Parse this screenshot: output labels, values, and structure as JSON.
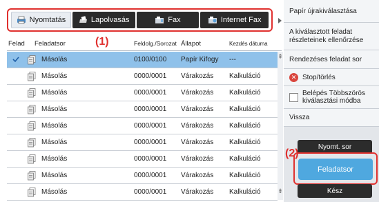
{
  "tabs": [
    {
      "label": "Nyomtatás",
      "icon": "printer-icon",
      "active": true
    },
    {
      "label": "Lapolvasás",
      "icon": "scanner-icon",
      "active": false
    },
    {
      "label": "Fax",
      "icon": "fax-icon",
      "active": false
    },
    {
      "label": "Internet Fax",
      "icon": "internet-fax-icon",
      "active": false
    }
  ],
  "annotations": {
    "one": "(1)",
    "two": "(2)"
  },
  "table": {
    "headers": {
      "feladat": "Felad",
      "feladatsor": "Feladatsor",
      "sorozat": "Feldolg./Sorozat",
      "allapot": "Állapot",
      "kezdes": "Kezdés dátuma"
    },
    "rows": [
      {
        "feladatsor": "Másolás",
        "sorozat": "0100/0100",
        "allapot": "Papír Kifogy",
        "kezdes": "---",
        "selected": true
      },
      {
        "feladatsor": "Másolás",
        "sorozat": "0000/0001",
        "allapot": "Várakozás",
        "kezdes": "Kalkuláció",
        "selected": false
      },
      {
        "feladatsor": "Másolás",
        "sorozat": "0000/0001",
        "allapot": "Várakozás",
        "kezdes": "Kalkuláció",
        "selected": false
      },
      {
        "feladatsor": "Másolás",
        "sorozat": "0000/0001",
        "allapot": "Várakozás",
        "kezdes": "Kalkuláció",
        "selected": false
      },
      {
        "feladatsor": "Másolás",
        "sorozat": "0000/0001",
        "allapot": "Várakozás",
        "kezdes": "Kalkuláció",
        "selected": false
      },
      {
        "feladatsor": "Másolás",
        "sorozat": "0000/0001",
        "allapot": "Várakozás",
        "kezdes": "Kalkuláció",
        "selected": false
      },
      {
        "feladatsor": "Másolás",
        "sorozat": "0000/0001",
        "allapot": "Várakozás",
        "kezdes": "Kalkuláció",
        "selected": false
      },
      {
        "feladatsor": "Másolás",
        "sorozat": "0000/0001",
        "allapot": "Várakozás",
        "kezdes": "Kalkuláció",
        "selected": false
      },
      {
        "feladatsor": "Másolás",
        "sorozat": "0000/0001",
        "allapot": "Várakozás",
        "kezdes": "Kalkuláció",
        "selected": false
      }
    ]
  },
  "side": {
    "paper_reselect": "Papír újrakiválasztása",
    "check_selected": "A kiválasztott feladat részleteinek ellenőrzése",
    "priority": "Rendezéses feladat sor",
    "stop_delete": "Stop/törlés",
    "multi_select": "Belépés Többszörös kiválasztási módba",
    "back": "Vissza",
    "print_queue": "Nyomt. sor",
    "job_queue": "Feladatsor",
    "done": "Kész"
  },
  "colors": {
    "accent_red": "#e0302e",
    "selected_row": "#8fc1ea",
    "blue_button": "#4fa8df",
    "dark_button": "#2c2c2c"
  }
}
